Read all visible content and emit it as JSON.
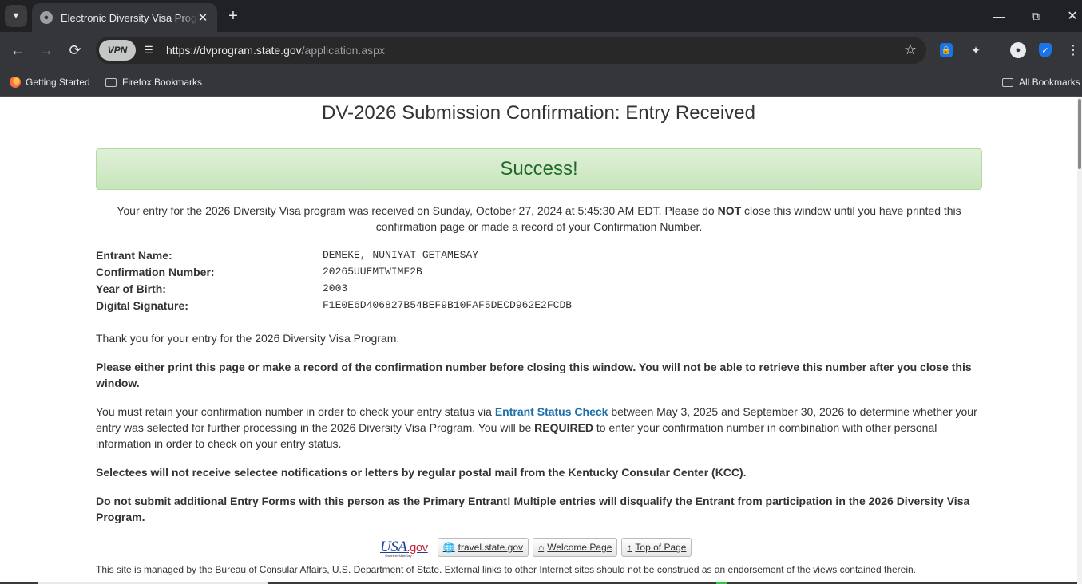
{
  "browser": {
    "tab_title": "Electronic Diversity Visa Program",
    "url_host": "https://dvprogram.state.gov",
    "url_path": "/application.aspx",
    "vpn_label": "VPN",
    "bookmarks": [
      {
        "label": "Getting Started",
        "icon": "firefox-icon"
      },
      {
        "label": "Firefox Bookmarks",
        "icon": "folder-icon"
      }
    ],
    "all_bookmarks": "All Bookmarks"
  },
  "page": {
    "title": "DV-2026 Submission Confirmation: Entry Received",
    "success": "Success!",
    "received_pre": "Your entry for the 2026 Diversity Visa program was received on Sunday, October 27, 2024 at 5:45:30 AM EDT. Please do ",
    "received_not": "NOT",
    "received_post": " close this window until you have printed this confirmation page or made a record of your Confirmation Number.",
    "fields": [
      {
        "label": "Entrant Name:",
        "value": "DEMEKE, NUNIYAT GETAMESAY"
      },
      {
        "label": "Confirmation Number:",
        "value": "20265UUEMTWIMF2B"
      },
      {
        "label": "Year of Birth:",
        "value": "2003"
      },
      {
        "label": "Digital Signature:",
        "value": "F1E0E6D406827B54BEF9B10FAF5DECD962E2FCDB"
      }
    ],
    "thank_you": "Thank you for your entry for the 2026 Diversity Visa Program.",
    "print_notice": "Please either print this page or make a record of the confirmation number before closing this window. You will not be able to retrieve this number after you close this window.",
    "retain_pre": "You must retain your confirmation number in order to check your entry status via ",
    "retain_link": "Entrant Status Check",
    "retain_mid": " between May 3, 2025 and September 30, 2026 to determine whether your entry was selected for further processing in the 2026 Diversity Visa Program. You will be ",
    "retain_required": "REQUIRED",
    "retain_post": " to enter your confirmation number in combination with other personal information in order to check on your entry status.",
    "selectees": "Selectees will not receive selectee notifications or letters by regular postal mail from the Kentucky Consular Center (KCC).",
    "do_not_submit": "Do not submit additional Entry Forms with this person as the Primary Entrant! Multiple entries will disqualify the Entrant from participation in the 2026 Diversity Visa Program.",
    "usa_logo_main": "USA",
    "usa_logo_gov": ".gov",
    "usa_logo_tagline": "Government Made Easy",
    "footer_buttons": [
      {
        "label": "travel.state.gov",
        "icon": "globe-icon"
      },
      {
        "label": "Welcome Page",
        "icon": "home-icon"
      },
      {
        "label": "Top of Page",
        "icon": "arrow-up-icon"
      }
    ],
    "footer_note": "This site is managed by the Bureau of Consular Affairs, U.S. Department of State. External links to other Internet sites should not be construed as an endorsement of the views contained therein."
  },
  "colors": {
    "success_text": "#1f6b2a",
    "success_bg": "#dff0d8",
    "link": "#1f6fa9"
  }
}
